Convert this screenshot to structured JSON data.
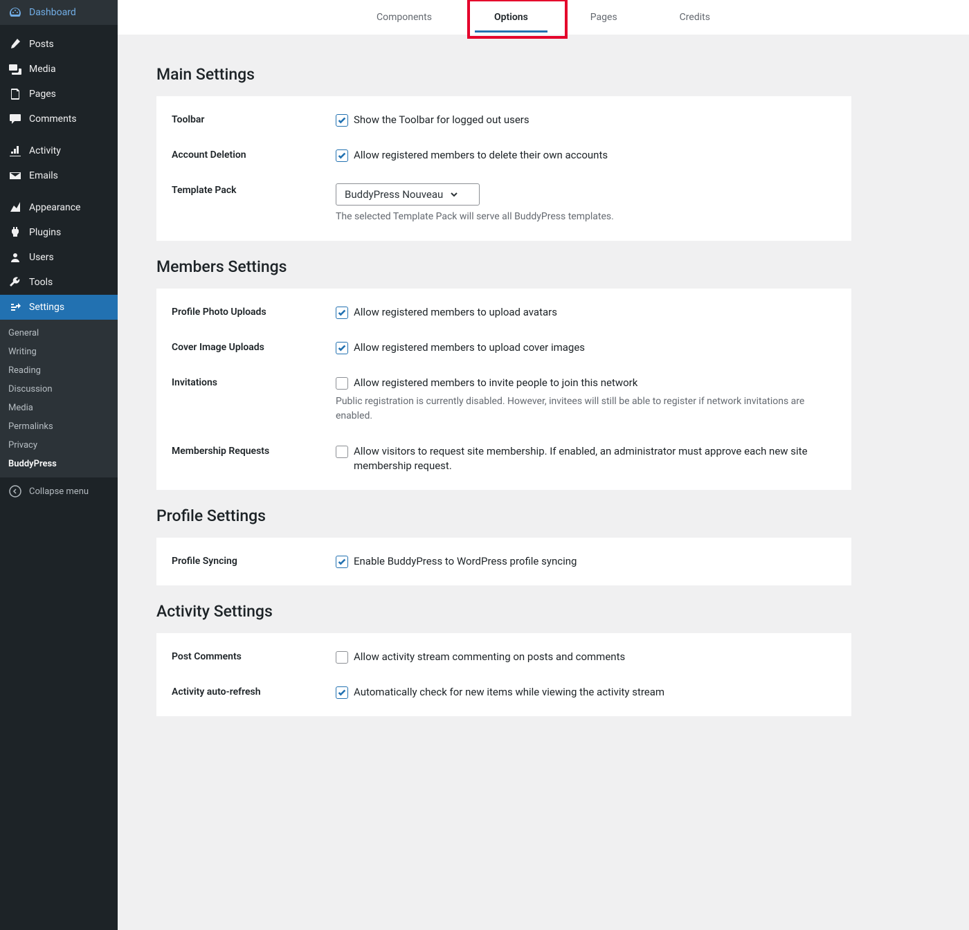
{
  "sidebar": {
    "items": [
      {
        "label": "Dashboard",
        "icon": "dashboard"
      },
      {
        "label": "Posts",
        "icon": "posts"
      },
      {
        "label": "Media",
        "icon": "media"
      },
      {
        "label": "Pages",
        "icon": "pages"
      },
      {
        "label": "Comments",
        "icon": "comments"
      },
      {
        "label": "Activity",
        "icon": "activity"
      },
      {
        "label": "Emails",
        "icon": "emails"
      },
      {
        "label": "Appearance",
        "icon": "appearance"
      },
      {
        "label": "Plugins",
        "icon": "plugins"
      },
      {
        "label": "Users",
        "icon": "users"
      },
      {
        "label": "Tools",
        "icon": "tools"
      },
      {
        "label": "Settings",
        "icon": "settings"
      }
    ],
    "submenu": [
      {
        "label": "General"
      },
      {
        "label": "Writing"
      },
      {
        "label": "Reading"
      },
      {
        "label": "Discussion"
      },
      {
        "label": "Media"
      },
      {
        "label": "Permalinks"
      },
      {
        "label": "Privacy"
      },
      {
        "label": "BuddyPress"
      }
    ],
    "collapse": "Collapse menu"
  },
  "tabs": [
    {
      "label": "Components"
    },
    {
      "label": "Options"
    },
    {
      "label": "Pages"
    },
    {
      "label": "Credits"
    }
  ],
  "sections": {
    "main": {
      "title": "Main Settings",
      "toolbar": {
        "label": "Toolbar",
        "text": "Show the Toolbar for logged out users",
        "checked": true
      },
      "account_deletion": {
        "label": "Account Deletion",
        "text": "Allow registered members to delete their own accounts",
        "checked": true
      },
      "template_pack": {
        "label": "Template Pack",
        "selected": "BuddyPress Nouveau",
        "desc": "The selected Template Pack will serve all BuddyPress templates."
      }
    },
    "members": {
      "title": "Members Settings",
      "profile_photo": {
        "label": "Profile Photo Uploads",
        "text": "Allow registered members to upload avatars",
        "checked": true
      },
      "cover_image": {
        "label": "Cover Image Uploads",
        "text": "Allow registered members to upload cover images",
        "checked": true
      },
      "invitations": {
        "label": "Invitations",
        "text": "Allow registered members to invite people to join this network",
        "checked": false,
        "desc": "Public registration is currently disabled. However, invitees will still be able to register if network invitations are enabled."
      },
      "membership": {
        "label": "Membership Requests",
        "text": "Allow visitors to request site membership. If enabled, an administrator must approve each new site membership request.",
        "checked": false
      }
    },
    "profile": {
      "title": "Profile Settings",
      "syncing": {
        "label": "Profile Syncing",
        "text": "Enable BuddyPress to WordPress profile syncing",
        "checked": true
      }
    },
    "activity": {
      "title": "Activity Settings",
      "post_comments": {
        "label": "Post Comments",
        "text": "Allow activity stream commenting on posts and comments",
        "checked": false
      },
      "auto_refresh": {
        "label": "Activity auto-refresh",
        "text": "Automatically check for new items while viewing the activity stream",
        "checked": true
      }
    }
  }
}
